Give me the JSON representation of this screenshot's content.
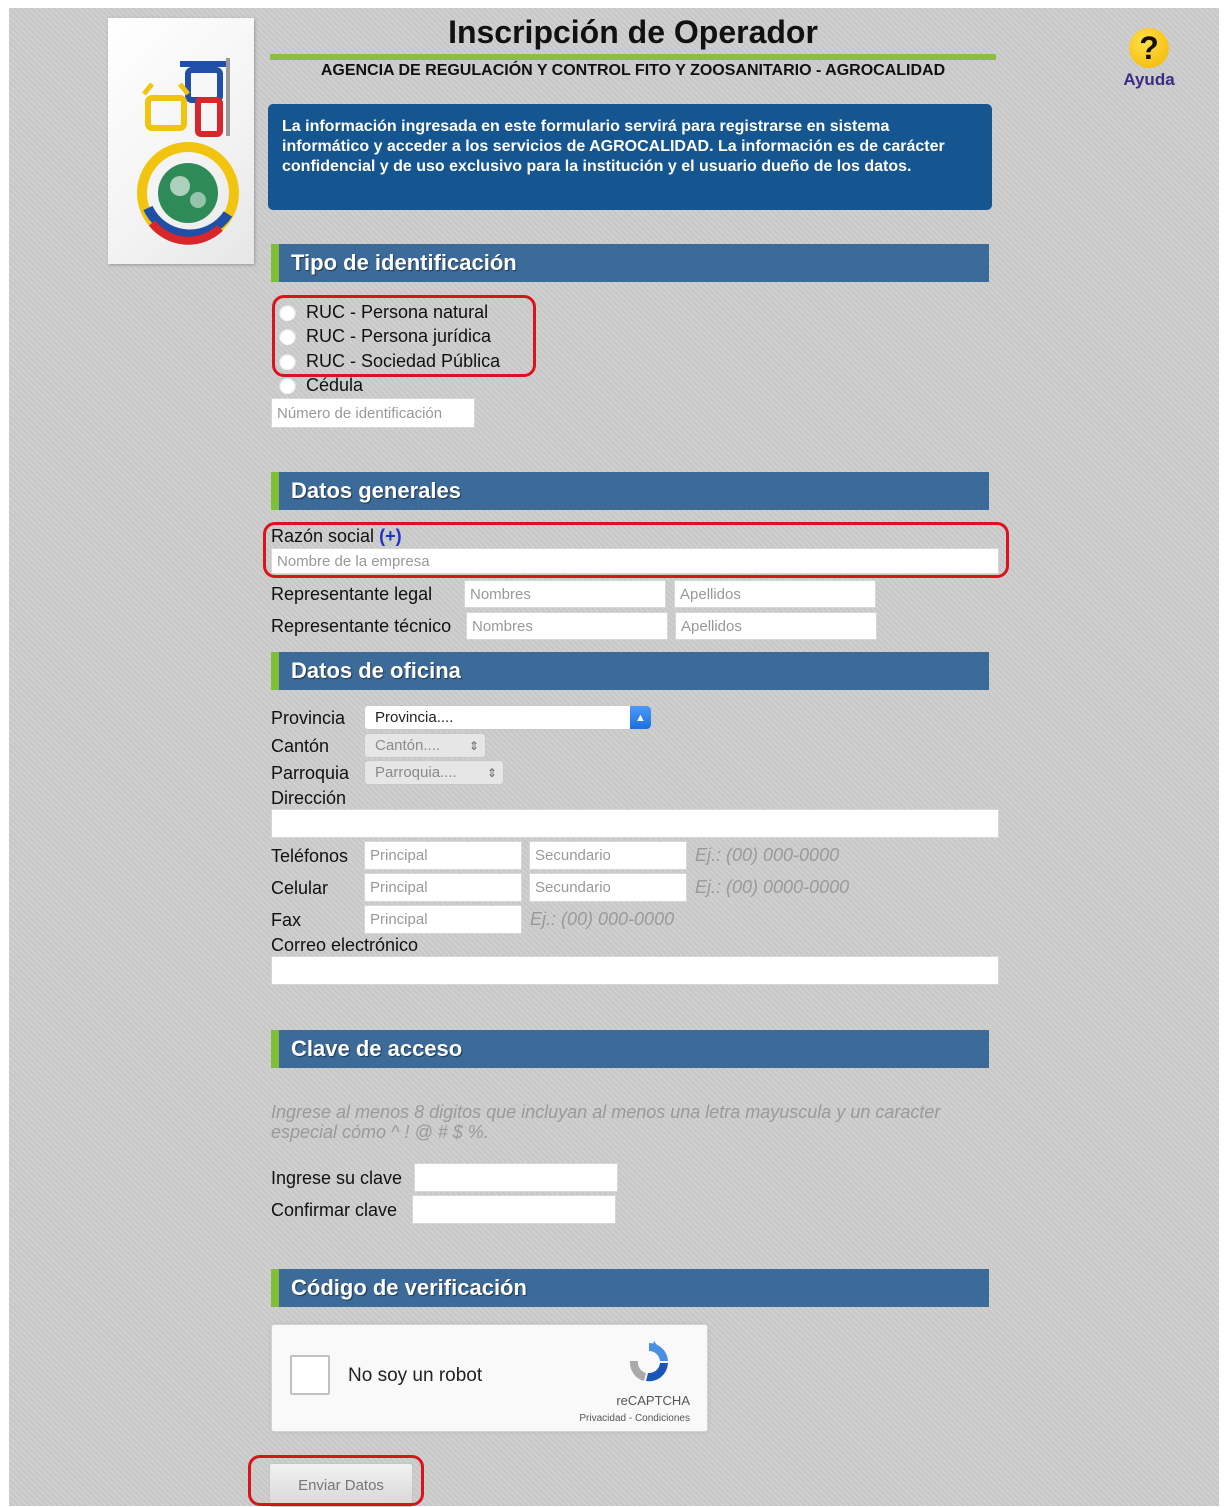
{
  "header": {
    "title": "Inscripción de Operador",
    "agency": "AGENCIA DE REGULACIÓN Y CONTROL FITO Y ZOOSANITARIO - AGROCALIDAD",
    "info_text": "La información ingresada en este formulario servirá para registrarse en sistema informático y acceder a los servicios de AGROCALIDAD. La información es de carácter confidencial y de uso exclusivo para la institución y el usuario dueño de los datos.",
    "help_label": "Ayuda",
    "help_glyph": "?"
  },
  "identification": {
    "section_title": "Tipo de identificación",
    "options": [
      "RUC - Persona natural",
      "RUC - Persona jurídica",
      "RUC - Sociedad Pública",
      "Cédula"
    ],
    "number_placeholder": "Número de identificación"
  },
  "general": {
    "section_title": "Datos generales",
    "razon_label": "Razón social",
    "razon_plus": "(+)",
    "razon_placeholder": "Nombre de la empresa",
    "legal_label": "Representante legal",
    "tecnico_label": "Representante técnico",
    "nombres_placeholder": "Nombres",
    "apellidos_placeholder": "Apellidos"
  },
  "office": {
    "section_title": "Datos de oficina",
    "provincia_label": "Provincia",
    "provincia_value": "Provincia....",
    "canton_label": "Cantón",
    "canton_value": "Cantón....",
    "parroquia_label": "Parroquia",
    "parroquia_value": "Parroquia....",
    "direccion_label": "Dirección",
    "telefonos_label": "Teléfonos",
    "celular_label": "Celular",
    "fax_label": "Fax",
    "principal_placeholder": "Principal",
    "secundario_placeholder": "Secundario",
    "phone_hint": "Ej.: (00) 000-0000",
    "cell_hint": "Ej.: (00) 0000-0000",
    "fax_hint": "Ej.: (00) 000-0000",
    "correo_label": "Correo electrónico"
  },
  "password": {
    "section_title": "Clave de acceso",
    "hint": "Ingrese al menos 8 digitos que incluyan al menos una letra mayuscula y un caracter especial cómo ^ ! @ # $ %.",
    "ingrese_label": "Ingrese su clave",
    "confirmar_label": "Confirmar clave"
  },
  "verification": {
    "section_title": "Código de verificación",
    "captcha_label": "No soy un robot",
    "captcha_brand": "reCAPTCHA",
    "captcha_links": "Privacidad - Condiciones"
  },
  "submit_label": "Enviar Datos",
  "colors": {
    "section_bg": "#3c6b9a",
    "section_accent": "#7fbf3a",
    "info_bg": "#155590",
    "highlight": "#d9141c"
  }
}
